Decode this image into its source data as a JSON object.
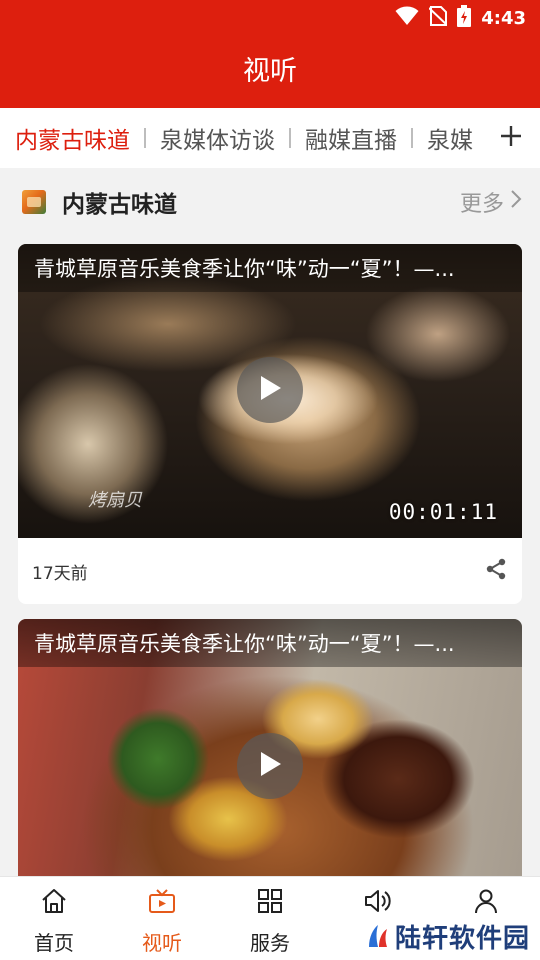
{
  "status_bar": {
    "time": "4:43"
  },
  "header": {
    "title": "视听"
  },
  "tabs": [
    {
      "label": "内蒙古味道",
      "active": true
    },
    {
      "label": "泉媒体访谈",
      "active": false
    },
    {
      "label": "融媒直播",
      "active": false
    },
    {
      "label": "泉媒",
      "active": false
    }
  ],
  "section": {
    "title": "内蒙古味道",
    "more_label": "更多"
  },
  "videos": [
    {
      "title": "青城草原音乐美食季让你“味”动一“夏”！—...",
      "duration": "00:01:11",
      "watermark": "烤扇贝",
      "time_ago": "17天前"
    },
    {
      "title": "青城草原音乐美食季让你“味”动一“夏”！—..."
    }
  ],
  "bottom_nav": [
    {
      "label": "首页",
      "icon": "home-icon",
      "active": false
    },
    {
      "label": "视听",
      "icon": "tv-icon",
      "active": true
    },
    {
      "label": "服务",
      "icon": "grid-icon",
      "active": false
    },
    {
      "label": "",
      "icon": "speaker-icon",
      "active": false
    },
    {
      "label": "",
      "icon": "user-icon",
      "active": false
    }
  ],
  "brand_watermark": "陆轩软件园",
  "colors": {
    "primary": "#dd1f0e",
    "accent": "#e55a1a",
    "tab_active": "#dd1f0e"
  }
}
